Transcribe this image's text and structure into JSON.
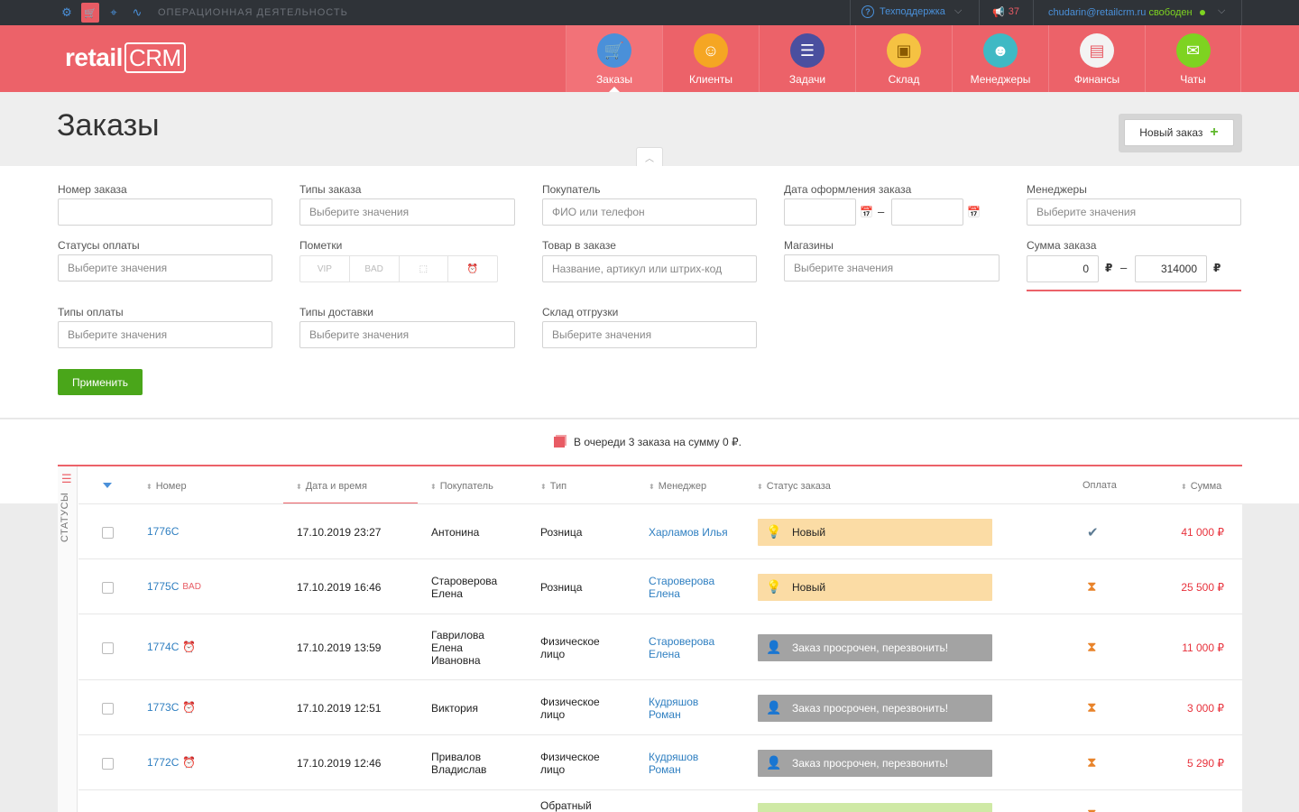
{
  "topbar": {
    "section": "ОПЕРАЦИОННАЯ ДЕЯТЕЛЬНОСТЬ",
    "support": "Техподдержка",
    "notifications": "37",
    "email": "chudarin@retailcrm.ru",
    "status": "свободен"
  },
  "logo": {
    "retail": "retail",
    "crm": "CRM"
  },
  "nav": [
    {
      "label": "Заказы",
      "icon": "cart-icon",
      "color": "#4a90d9"
    },
    {
      "label": "Клиенты",
      "icon": "client-icon",
      "color": "#f5a623"
    },
    {
      "label": "Задачи",
      "icon": "tasks-icon",
      "color": "#4a4f9f"
    },
    {
      "label": "Склад",
      "icon": "box-icon",
      "color": "#f5c242"
    },
    {
      "label": "Менеджеры",
      "icon": "manager-icon",
      "color": "#3fb9c4"
    },
    {
      "label": "Финансы",
      "icon": "finance-icon",
      "color": "#f3f3f3"
    },
    {
      "label": "Чаты",
      "icon": "chat-icon",
      "color": "#7ed321"
    }
  ],
  "page": {
    "title": "Заказы",
    "new_order": "Новый заказ"
  },
  "filters": {
    "order_number": "Номер заказа",
    "order_types": "Типы заказа",
    "order_types_ph": "Выберите значения",
    "buyer": "Покупатель",
    "buyer_ph": "ФИО или телефон",
    "order_date": "Дата оформления заказа",
    "managers": "Менеджеры",
    "managers_ph": "Выберите значения",
    "payment_statuses": "Статусы оплаты",
    "payment_statuses_ph": "Выберите значения",
    "marks": "Пометки",
    "marks_items": [
      "VIP",
      "BAD",
      "⬚",
      "⏰"
    ],
    "product": "Товар в заказе",
    "product_ph": "Название, артикул или штрих-код",
    "shops": "Магазины",
    "shops_ph": "Выберите значения",
    "order_sum": "Сумма заказа",
    "sum_from": "0",
    "sum_to": "314000",
    "currency": "₽",
    "payment_types": "Типы оплаты",
    "payment_types_ph": "Выберите значения",
    "delivery_types": "Типы доставки",
    "delivery_types_ph": "Выберите значения",
    "warehouse": "Склад отгрузки",
    "warehouse_ph": "Выберите значения",
    "apply": "Применить"
  },
  "queue": "В очереди 3 заказа на сумму 0 ₽.",
  "table": {
    "side_label": "СТАТУСЫ",
    "headers": {
      "number": "Номер",
      "datetime": "Дата и время",
      "buyer": "Покупатель",
      "type": "Тип",
      "manager": "Менеджер",
      "status": "Статус заказа",
      "payment": "Оплата",
      "sum": "Сумма"
    },
    "rows": [
      {
        "number": "1776C",
        "badge": "",
        "alarm": false,
        "datetime": "17.10.2019 23:27",
        "buyer": "Антонина",
        "type": "Розница",
        "manager": "Харламов Илья",
        "status": "Новый",
        "status_kind": "new",
        "payment": "paid",
        "sum": "41 000 ₽"
      },
      {
        "number": "1775C",
        "badge": "BAD",
        "alarm": false,
        "datetime": "17.10.2019 16:46",
        "buyer": "Староверова Елена",
        "type": "Розница",
        "manager": "Староверова Елена",
        "status": "Новый",
        "status_kind": "new",
        "payment": "wait",
        "sum": "25 500 ₽"
      },
      {
        "number": "1774C",
        "badge": "",
        "alarm": true,
        "datetime": "17.10.2019 13:59",
        "buyer": "Гаврилова Елена Ивановна",
        "type": "Физическое лицо",
        "manager": "Староверова Елена",
        "status": "Заказ просрочен, перезвонить!",
        "status_kind": "late",
        "payment": "wait",
        "sum": "11 000 ₽"
      },
      {
        "number": "1773C",
        "badge": "",
        "alarm": true,
        "datetime": "17.10.2019 12:51",
        "buyer": "Виктория",
        "type": "Физическое лицо",
        "manager": "Кудряшов Роман",
        "status": "Заказ просрочен, перезвонить!",
        "status_kind": "late",
        "payment": "wait",
        "sum": "3 000 ₽"
      },
      {
        "number": "1772C",
        "badge": "",
        "alarm": true,
        "datetime": "17.10.2019 12:46",
        "buyer": "Привалов Владислав",
        "type": "Физическое лицо",
        "manager": "Кудряшов Роман",
        "status": "Заказ просрочен, перезвонить!",
        "status_kind": "late",
        "payment": "wait",
        "sum": "5 290 ₽"
      },
      {
        "number": "",
        "badge": "",
        "alarm": false,
        "datetime": "",
        "buyer": "",
        "type": "Обратный",
        "manager": "",
        "status": "",
        "status_kind": "green",
        "payment": "wait",
        "sum": ""
      }
    ]
  }
}
